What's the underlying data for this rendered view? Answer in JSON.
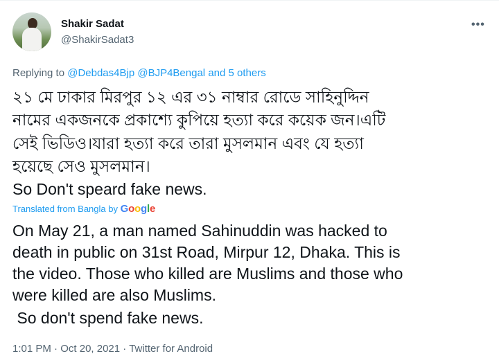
{
  "author": {
    "name": "Shakir Sadat",
    "handle": "@ShakirSadat3"
  },
  "reply_context": {
    "prefix": "Replying to ",
    "mention_1": "@Debdas4Bjp",
    "mention_2": "@BJP4Bengal",
    "others": "and 5 others"
  },
  "tweet": {
    "bangla_lines": [
      "২১ মে ঢাকার মিরপুর ১২ এর ৩১ নাম্বার রোডে সাহিনুদ্দিন",
      "নামের একজনকে প্রকাশ্যে কুপিয়ে হত্যা করে কয়েক জন।এটি",
      "সেই ভিডিও।যারা হত্যা করে তারা মুসলমান এবং যে হত্যা",
      "হয়েছে সেও মুসলমান।"
    ],
    "english_line": "So Don't speard fake news."
  },
  "translation": {
    "label": "Translated from Bangla by",
    "provider": "Google",
    "lines": [
      "On May 21, a man named Sahinuddin was hacked to",
      "death in public on 31st Road, Mirpur 12, Dhaka. This is",
      "the video. Those who killed are Muslims and those who",
      "were killed are also Muslims.",
      " So don't spend fake news."
    ]
  },
  "meta": {
    "time": "1:01 PM",
    "separator": "·",
    "date": "Oct 20, 2021",
    "app": "Twitter for Android"
  },
  "colors": {
    "text": "#0f1419",
    "secondary": "#536471",
    "link": "#1d9bf0",
    "google_blue": "#4285f4",
    "google_red": "#ea4335",
    "google_yellow": "#fbbc05",
    "google_green": "#34a853"
  },
  "icons": {
    "more": "more-horizontal-icon"
  }
}
